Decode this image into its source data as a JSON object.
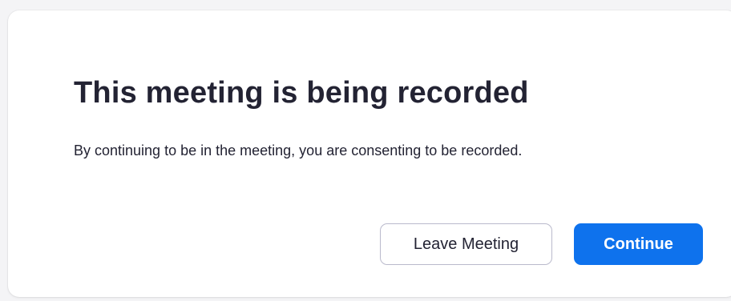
{
  "dialog": {
    "title": "This meeting is being recorded",
    "message": "By continuing to be in the meeting, you are consenting to be recorded.",
    "buttons": {
      "leave_label": "Leave Meeting",
      "continue_label": "Continue"
    }
  },
  "colors": {
    "primary": "#0e72ed",
    "text": "#232333",
    "secondary_border": "#babacc"
  }
}
